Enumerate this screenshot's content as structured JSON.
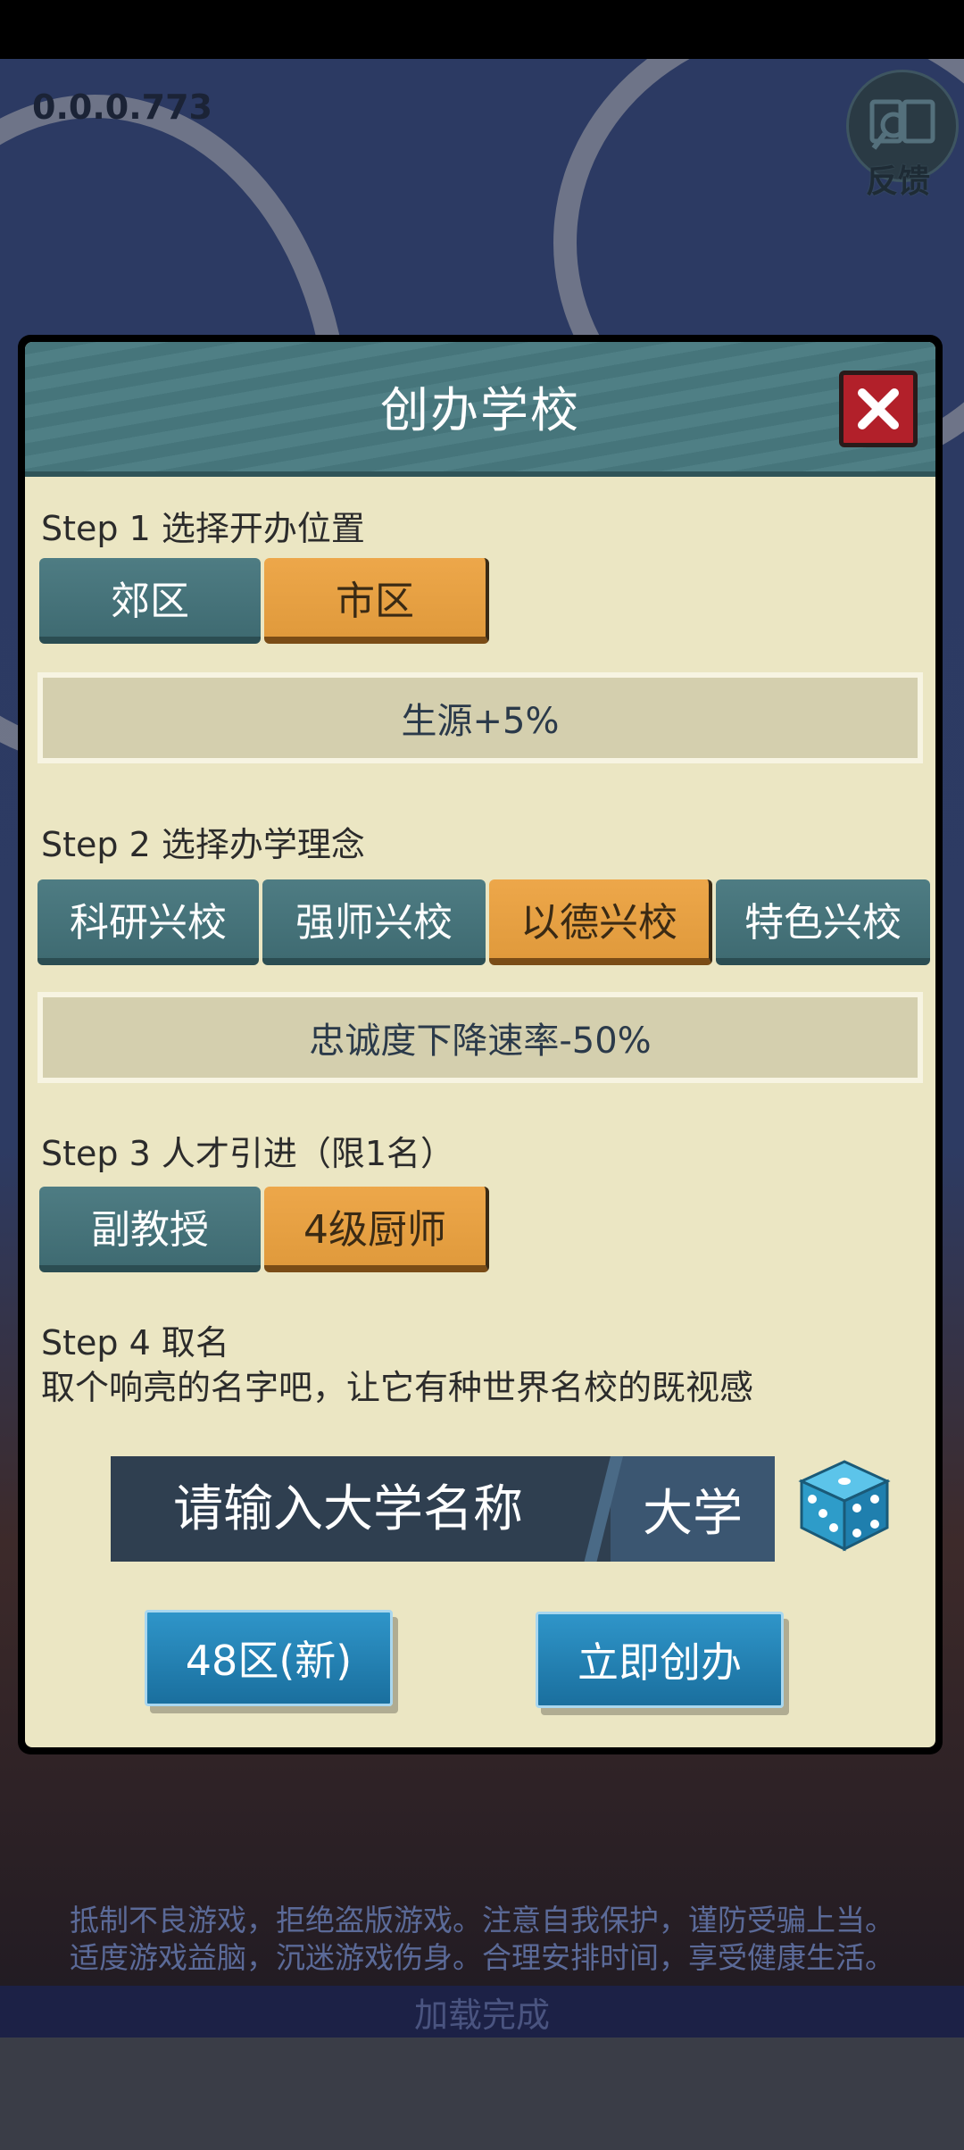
{
  "app": {
    "version": "0.0.0.773",
    "feedback_label": "反馈"
  },
  "dialog": {
    "title": "创办学校",
    "step1": {
      "label": "Step 1 选择开办位置",
      "options": [
        "郊区",
        "市区"
      ],
      "selected": "市区",
      "effect": "生源+5%"
    },
    "step2": {
      "label": "Step 2 选择办学理念",
      "options": [
        "科研兴校",
        "强师兴校",
        "以德兴校",
        "特色兴校"
      ],
      "selected": "以德兴校",
      "effect": "忠诚度下降速率-50%"
    },
    "step3": {
      "label": "Step 3 人才引进（限1名）",
      "options": [
        "副教授",
        "4级厨师"
      ],
      "selected": "4级厨师"
    },
    "step4": {
      "label": "Step 4 取名",
      "description": "取个响亮的名字吧，让它有种世界名校的既视感",
      "name_input": {
        "placeholder": "请输入大学名称",
        "value": "",
        "suffix": "大学"
      }
    },
    "server_button": "48区(新)",
    "create_button": "立即创办"
  },
  "footer": {
    "notice_line1": "抵制不良游戏，拒绝盗版游戏。注意自我保护，谨防受骗上当。",
    "notice_line2": "适度游戏益脑，沉迷游戏伤身。合理安排时间，享受健康生活。",
    "loading_status": "加载完成"
  },
  "colors": {
    "teal_button": "#4e7c83",
    "orange_selected": "#eda74a",
    "dialog_bg": "#ebe6c3",
    "action_blue": "#2f95c9",
    "close_red": "#b2202a"
  }
}
